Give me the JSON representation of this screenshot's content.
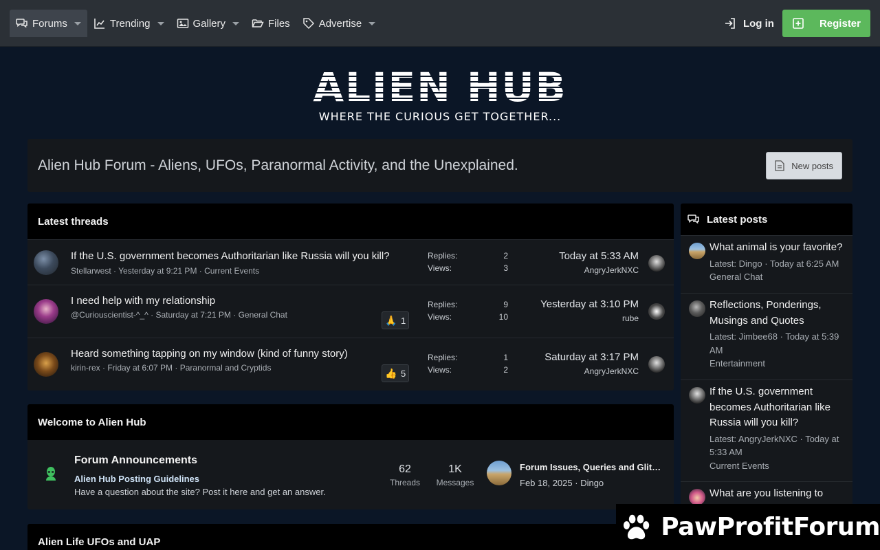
{
  "nav": {
    "tabs": [
      {
        "label": "Forums",
        "icon": "comments-icon",
        "active": true,
        "has_caret": true
      },
      {
        "label": "Trending",
        "icon": "chart-line-icon",
        "has_caret": true
      },
      {
        "label": "Gallery",
        "icon": "image-icon",
        "has_caret": true
      },
      {
        "label": "Files",
        "icon": "folder-open-icon",
        "has_caret": false
      },
      {
        "label": "Advertise",
        "icon": "tag-icon",
        "has_caret": true
      }
    ],
    "login_label": "Log in",
    "register_label": "Register"
  },
  "logo": {
    "main": "ALIEN HUB",
    "tagline": "WHERE THE CURIOUS GET TOGETHER..."
  },
  "page": {
    "title": "Alien Hub Forum - Aliens, UFOs, Paranormal Activity, and the Unexplained.",
    "new_posts_label": "New posts"
  },
  "latest_threads": {
    "heading": "Latest threads",
    "replies_label": "Replies:",
    "views_label": "Views:",
    "items": [
      {
        "title": "If the U.S. government becomes Authoritarian like Russia will you kill?",
        "author": "Stellarwest",
        "started": "Yesterday at 9:21 PM",
        "forum": "Current Events",
        "replies": "2",
        "views": "3",
        "last_time": "Today at 5:33 AM",
        "last_user": "AngryJerkNXC"
      },
      {
        "title": "I need help with my relationship",
        "author": "@Curiouscientist-^_^",
        "started": "Saturday at 7:21 PM",
        "forum": "General Chat",
        "replies": "9",
        "views": "10",
        "last_time": "Yesterday at 3:10 PM",
        "last_user": "rube",
        "reaction_emoji": "🙏",
        "reaction_count": "1"
      },
      {
        "title": "Heard something tapping on my window (kind of funny story)",
        "author": "kirin-rex",
        "started": "Friday at 6:07 PM",
        "forum": "Paranormal and Cryptids",
        "replies": "1",
        "views": "2",
        "last_time": "Saturday at 3:17 PM",
        "last_user": "AngryJerkNXC",
        "reaction_emoji": "👍",
        "reaction_count": "5"
      }
    ]
  },
  "welcome": {
    "heading": "Welcome to Alien Hub",
    "forum": {
      "title": "Forum Announcements",
      "subforum": "Alien Hub Posting Guidelines",
      "description": "Have a question about the site? Post it here and get an answer.",
      "threads": "62",
      "threads_label": "Threads",
      "messages": "1K",
      "messages_label": "Messages",
      "last_title": "Forum Issues, Queries and Glitches",
      "last_date": "Feb 18, 2025",
      "last_user": "Dingo"
    }
  },
  "alien_life": {
    "heading": "Alien Life UFOs and UAP"
  },
  "latest_posts": {
    "heading": "Latest posts",
    "items": [
      {
        "title": "What animal is your favorite?",
        "meta": "Latest: Dingo · Today at 6:25 AM",
        "forum": "General Chat"
      },
      {
        "title": "Reflections, Ponderings, Musings and Quotes",
        "meta": "Latest: Jimbee68 · Today at 5:39 AM",
        "forum": "Entertainment"
      },
      {
        "title": "If the U.S. government becomes Authoritarian like Russia will you kill?",
        "meta": "Latest: AngryJerkNXC · Today at 5:33 AM",
        "forum": "Current Events"
      },
      {
        "title": "What are you listening to",
        "meta": "",
        "forum": ""
      }
    ]
  },
  "watermark": {
    "text": "PawProfitForum"
  },
  "colors": {
    "register": "#5cb85c",
    "topbar": "#2b3036",
    "background": "#0b1626",
    "block": "#15181c"
  }
}
